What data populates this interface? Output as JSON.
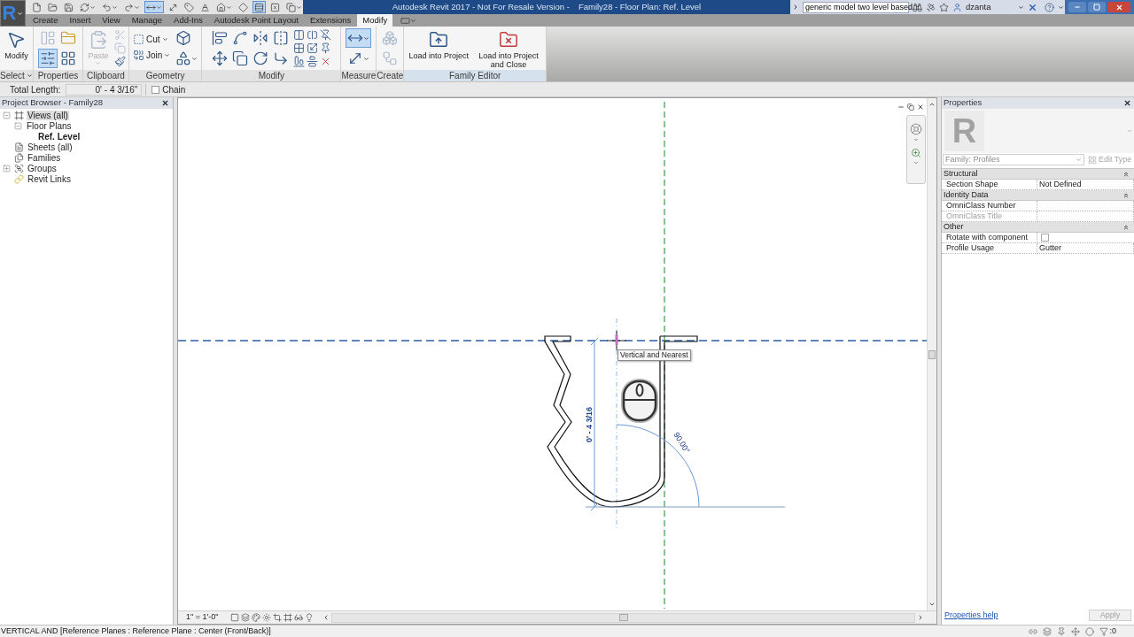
{
  "title_bar": {
    "app_button": "R",
    "quick_access": [
      {
        "selected": false,
        "dropdown": false
      },
      {
        "selected": false,
        "dropdown": false
      },
      {
        "selected": false,
        "dropdown": false
      },
      {
        "selected": false,
        "dropdown": true
      },
      {
        "selected": false,
        "dropdown": true
      },
      {
        "selected": false,
        "dropdown": true
      },
      {
        "selected": true,
        "dropdown": true
      },
      {
        "selected": false,
        "dropdown": false
      },
      {
        "selected": false,
        "dropdown": false
      },
      {
        "selected": false,
        "dropdown": false
      },
      {
        "selected": false,
        "dropdown": true
      },
      {
        "selected": false,
        "dropdown": false
      },
      {
        "selected": true,
        "dropdown": false
      },
      {
        "selected": false,
        "dropdown": false
      },
      {
        "selected": false,
        "dropdown": true
      }
    ],
    "title": "Autodesk Revit 2017 - Not For Resale Version -",
    "document": "Family28 - Floor Plan: Ref. Level",
    "search": {
      "value": "generic model two level based"
    },
    "user": "dzanta"
  },
  "ribbon_tabs": [
    {
      "label": "Create",
      "selected": false
    },
    {
      "label": "Insert",
      "selected": false
    },
    {
      "label": "View",
      "selected": false
    },
    {
      "label": "Manage",
      "selected": false
    },
    {
      "label": "Add-Ins",
      "selected": false
    },
    {
      "label": "Autodesk Point Layout",
      "selected": false
    },
    {
      "label": "Extensions",
      "selected": false
    },
    {
      "label": "Modify",
      "selected": true
    }
  ],
  "ribbon_panels": [
    {
      "label": "Select",
      "dropdown": true,
      "tools": [
        {
          "kind": "large",
          "label": "Modify",
          "selected": false,
          "disabled": false
        }
      ]
    },
    {
      "label": "Properties",
      "tools": [
        {
          "kind": "icon",
          "selected": false,
          "disabled": true
        },
        {
          "kind": "icon",
          "selected": true,
          "disabled": false
        },
        {
          "kind": "icon",
          "selected": false,
          "disabled": false
        },
        {
          "kind": "icon",
          "selected": false,
          "disabled": false
        }
      ]
    },
    {
      "label": "Clipboard",
      "tools": [
        {
          "kind": "large",
          "label": "Paste",
          "dropdown": true,
          "selected": false,
          "disabled": true
        },
        {
          "kind": "small",
          "selected": false,
          "disabled": true
        },
        {
          "kind": "small",
          "selected": false,
          "disabled": true
        },
        {
          "kind": "small",
          "selected": false,
          "disabled": false
        }
      ]
    },
    {
      "label": "Geometry",
      "tools": [
        {
          "kind": "labeled",
          "label": "Cut",
          "dropdown": true,
          "selected": false,
          "disabled": false
        },
        {
          "kind": "labeled",
          "label": "Join",
          "dropdown": true,
          "selected": false,
          "disabled": false
        },
        {
          "kind": "icon",
          "selected": false,
          "disabled": false
        },
        {
          "kind": "icon",
          "dropdown": true,
          "selected": false,
          "disabled": false
        }
      ]
    },
    {
      "label": "Modify",
      "tools": [
        {
          "kind": "icon",
          "selected": false,
          "disabled": false
        },
        {
          "kind": "icon",
          "selected": false,
          "disabled": false
        },
        {
          "kind": "icon",
          "selected": false,
          "disabled": false
        },
        {
          "kind": "icon",
          "selected": false,
          "disabled": false
        },
        {
          "kind": "icon",
          "selected": false,
          "disabled": false
        },
        {
          "kind": "icon",
          "selected": false,
          "disabled": false
        },
        {
          "kind": "icon",
          "selected": false,
          "disabled": false
        },
        {
          "kind": "icon",
          "selected": false,
          "disabled": false
        },
        {
          "kind": "small",
          "selected": false,
          "disabled": false
        },
        {
          "kind": "small",
          "selected": false,
          "disabled": false
        },
        {
          "kind": "small",
          "selected": false,
          "disabled": false
        },
        {
          "kind": "small",
          "selected": false,
          "disabled": false
        },
        {
          "kind": "small",
          "selected": false,
          "disabled": false
        },
        {
          "kind": "small",
          "selected": false,
          "disabled": false
        },
        {
          "kind": "small",
          "selected": false,
          "disabled": false
        },
        {
          "kind": "small",
          "selected": false,
          "disabled": false
        },
        {
          "kind": "small",
          "selected": false,
          "disabled": false
        }
      ]
    },
    {
      "label": "Measure",
      "tools": [
        {
          "kind": "icon",
          "dropdown": true,
          "selected": true,
          "disabled": false
        },
        {
          "kind": "icon",
          "dropdown": true,
          "selected": false,
          "disabled": false
        }
      ]
    },
    {
      "label": "Create",
      "tools": [
        {
          "kind": "icon",
          "selected": false,
          "disabled": true
        },
        {
          "kind": "icon",
          "selected": false,
          "disabled": true
        }
      ]
    },
    {
      "label": "Family Editor",
      "tools": [
        {
          "kind": "large",
          "label": "Load into Project",
          "selected": false,
          "disabled": false
        },
        {
          "kind": "large",
          "label": "Load into Project and Close",
          "selected": false,
          "disabled": false
        }
      ]
    }
  ],
  "options_bar": {
    "total_length": {
      "label": "Total Length:",
      "value": "0' - 4 3/16\""
    },
    "chain": {
      "label": "Chain",
      "checked": false
    }
  },
  "project_browser": {
    "title": "Project Browser - Family28",
    "tree": [
      {
        "label": "Views (all)",
        "expanded": true,
        "selected": true,
        "active": false,
        "children": [
          {
            "label": "Floor Plans",
            "expanded": true,
            "selected": false,
            "active": false,
            "children": [
              {
                "label": "Ref. Level",
                "selected": false,
                "active": true
              }
            ]
          }
        ]
      },
      {
        "label": "Sheets (all)",
        "selected": false,
        "active": false
      },
      {
        "label": "Families",
        "selected": false,
        "active": false
      },
      {
        "label": "Groups",
        "expanded": false,
        "selected": false,
        "active": false
      },
      {
        "label": "Revit Links",
        "selected": false,
        "active": false
      }
    ]
  },
  "canvas": {
    "dimension": "0' - 4 3/16",
    "angle": "90.00°",
    "tooltip": "Vertical and Nearest",
    "scale": "1\" = 1'-0\""
  },
  "properties": {
    "title": "Properties",
    "type_preview": "R",
    "type_selector": {
      "value": "Family: Profiles",
      "disabled": true
    },
    "edit_type": {
      "label": "Edit Type",
      "disabled": true
    },
    "groups": [
      {
        "label": "Structural",
        "expanded": true,
        "rows": [
          {
            "kind": "text",
            "name": "Section Shape",
            "value": "Not Defined",
            "disabled": false
          }
        ]
      },
      {
        "label": "Identity Data",
        "expanded": true,
        "rows": [
          {
            "kind": "text",
            "name": "OmniClass Number",
            "disabled": false
          },
          {
            "kind": "text",
            "name": "OmniClass Title",
            "disabled": true
          }
        ]
      },
      {
        "label": "Other",
        "expanded": true,
        "rows": [
          {
            "kind": "checkbox",
            "name": "Rotate with component",
            "checked": false,
            "disabled": false
          },
          {
            "kind": "text",
            "name": "Profile Usage",
            "value": "Gutter",
            "disabled": false
          }
        ]
      }
    ],
    "help_link": "Properties help",
    "apply": {
      "label": "Apply",
      "disabled": true
    }
  },
  "status_bar": {
    "message": "VERTICAL AND [Reference Planes : Reference Plane : Center (Front/Back)]",
    "filter_count": ":0"
  }
}
